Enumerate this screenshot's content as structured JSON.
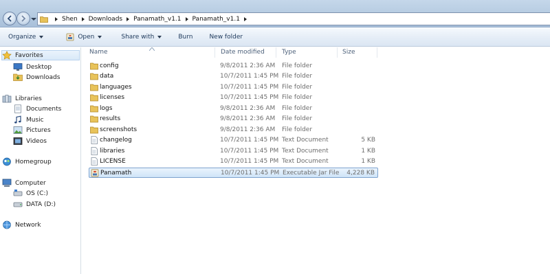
{
  "address_bar": {
    "breadcrumbs": [
      "Shen",
      "Downloads",
      "Panamath_v1.1",
      "Panamath_v1.1"
    ]
  },
  "toolbar": {
    "organize": "Organize",
    "open": "Open",
    "share_with": "Share with",
    "burn": "Burn",
    "new_folder": "New folder"
  },
  "nav_pane": {
    "favorites": {
      "label": "Favorites",
      "items": [
        "Desktop",
        "Downloads"
      ]
    },
    "libraries": {
      "label": "Libraries",
      "items": [
        "Documents",
        "Music",
        "Pictures",
        "Videos"
      ]
    },
    "homegroup": {
      "label": "Homegroup"
    },
    "computer": {
      "label": "Computer",
      "items": [
        "OS (C:)",
        "DATA (D:)"
      ]
    },
    "network": {
      "label": "Network"
    }
  },
  "file_list": {
    "columns": [
      "Name",
      "Date modified",
      "Type",
      "Size"
    ],
    "rows": [
      {
        "name": "config",
        "date": "9/8/2011 2:36 AM",
        "type": "File folder",
        "size": "",
        "icon": "folder-icon"
      },
      {
        "name": "data",
        "date": "10/7/2011 1:45 PM",
        "type": "File folder",
        "size": "",
        "icon": "folder-icon"
      },
      {
        "name": "languages",
        "date": "10/7/2011 1:45 PM",
        "type": "File folder",
        "size": "",
        "icon": "folder-icon"
      },
      {
        "name": "licenses",
        "date": "10/7/2011 1:45 PM",
        "type": "File folder",
        "size": "",
        "icon": "folder-icon"
      },
      {
        "name": "logs",
        "date": "9/8/2011 2:36 AM",
        "type": "File folder",
        "size": "",
        "icon": "folder-icon"
      },
      {
        "name": "results",
        "date": "9/8/2011 2:36 AM",
        "type": "File folder",
        "size": "",
        "icon": "folder-icon"
      },
      {
        "name": "screenshots",
        "date": "9/8/2011 2:36 AM",
        "type": "File folder",
        "size": "",
        "icon": "folder-icon"
      },
      {
        "name": "changelog",
        "date": "10/7/2011 1:45 PM",
        "type": "Text Document",
        "size": "5 KB",
        "icon": "text-document-icon"
      },
      {
        "name": "libraries",
        "date": "10/7/2011 1:45 PM",
        "type": "Text Document",
        "size": "1 KB",
        "icon": "text-document-icon"
      },
      {
        "name": "LICENSE",
        "date": "10/7/2011 1:45 PM",
        "type": "Text Document",
        "size": "1 KB",
        "icon": "text-document-icon"
      },
      {
        "name": "Panamath",
        "date": "10/7/2011 1:45 PM",
        "type": "Executable Jar File",
        "size": "4,228 KB",
        "icon": "jar-file-icon",
        "selected": true
      }
    ]
  },
  "colors": {
    "address_bar_bg": "#b9cde3",
    "toolbar_bg": "#e6eef7",
    "selection_border": "#7da2ce",
    "folder_yellow": "#e8c35a",
    "header_text": "#4c607a"
  }
}
